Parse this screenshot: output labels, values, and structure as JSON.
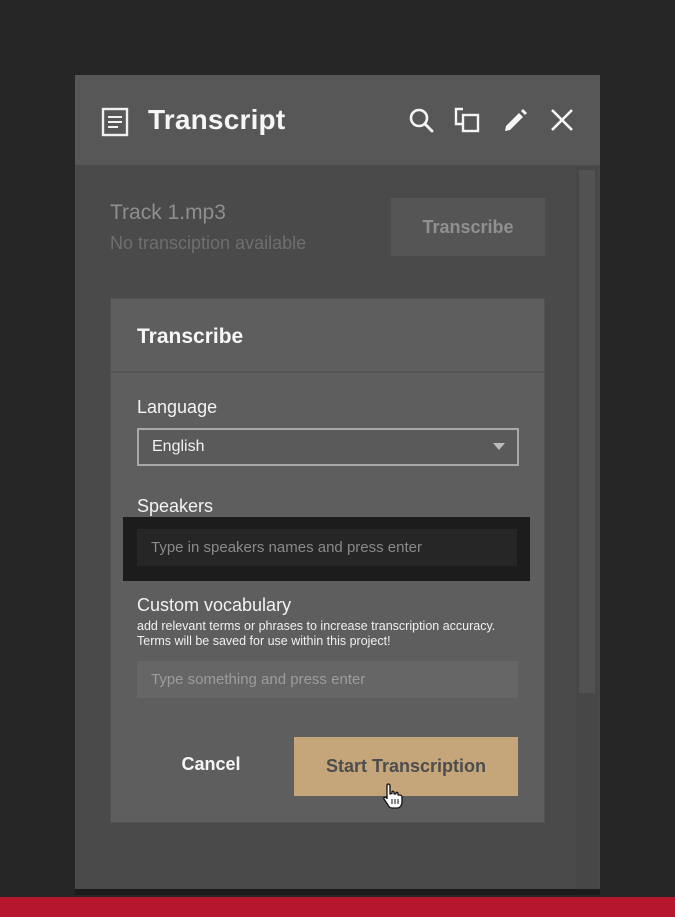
{
  "panel": {
    "title": "Transcript",
    "icons": {
      "title": "document-icon",
      "actions": [
        "search-icon",
        "copy-icon",
        "pencil-icon",
        "close-icon"
      ]
    }
  },
  "track": {
    "name": "Track 1.mp3",
    "status": "No transciption available",
    "transcribe_label": "Transcribe"
  },
  "dialog": {
    "title": "Transcribe",
    "language_label": "Language",
    "language_value": "English",
    "speakers_label": "Speakers",
    "speakers_placeholder": "Type in speakers names and press enter",
    "vocab_label": "Custom vocabulary",
    "vocab_help_line1": "add relevant terms or phrases to increase transcription accuracy.",
    "vocab_help_line2": "Terms will be saved for use within this project!",
    "vocab_placeholder": "Type something and press enter",
    "cancel_label": "Cancel",
    "start_label": "Start Transcription"
  },
  "colors": {
    "accent": "#c4a67a",
    "bottom_bar": "#b5172f",
    "panel_bg": "#4a4a4a"
  }
}
